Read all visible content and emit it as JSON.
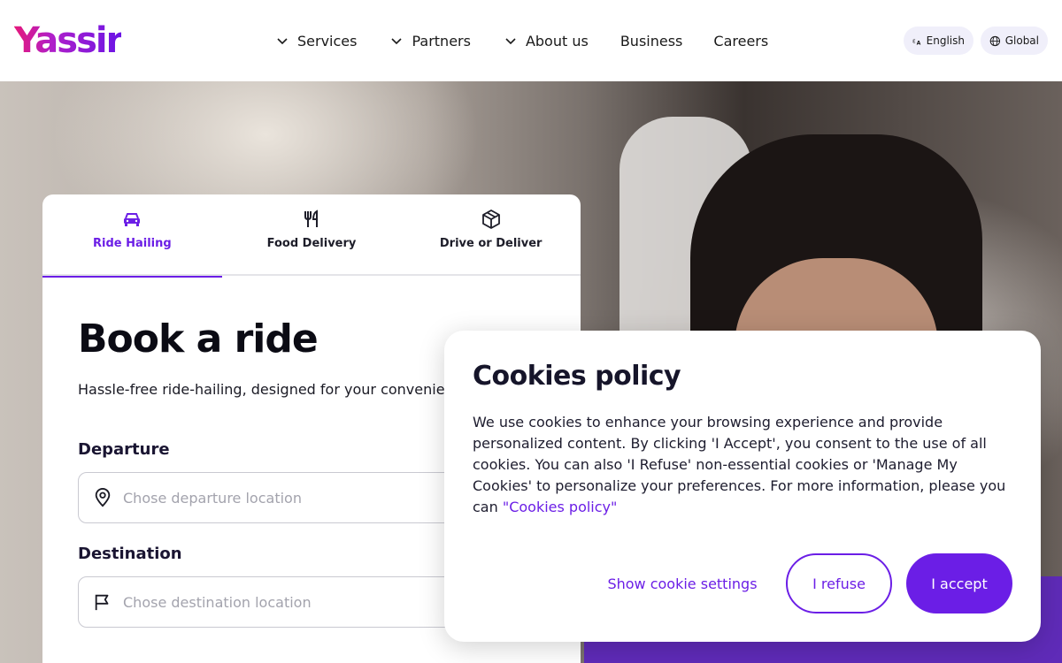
{
  "header": {
    "logo_text": "Yassir",
    "nav": {
      "services": "Services",
      "partners": "Partners",
      "about": "About us",
      "business": "Business",
      "careers": "Careers"
    },
    "language_label": "English",
    "region_label": "Global"
  },
  "booking": {
    "tabs": [
      {
        "label": "Ride Hailing",
        "icon": "car-icon",
        "active": true
      },
      {
        "label": "Food Delivery",
        "icon": "utensils-icon",
        "active": false
      },
      {
        "label": "Drive or Deliver",
        "icon": "box-icon",
        "active": false
      }
    ],
    "title": "Book a ride",
    "subtitle": "Hassle-free ride-hailing, designed for your convenience.",
    "departure": {
      "label": "Departure",
      "placeholder": "Chose departure location",
      "value": ""
    },
    "destination": {
      "label": "Destination",
      "placeholder": "Chose destination location",
      "value": ""
    }
  },
  "cookies": {
    "title": "Cookies policy",
    "text": "We use cookies to enhance your browsing experience and provide personalized content. By clicking 'I Accept', you consent to the use of all cookies. You can also 'I Refuse' non-essential cookies or 'Manage My Cookies' to personalize your preferences. For more information, please you can ",
    "link_text": "\"Cookies policy\"",
    "settings_label": "Show cookie settings",
    "refuse_label": "I refuse",
    "accept_label": "I accept"
  },
  "colors": {
    "accent": "#6b1ee6",
    "logo_gradient_start": "#e5197b",
    "logo_gradient_end": "#6b14e6"
  }
}
